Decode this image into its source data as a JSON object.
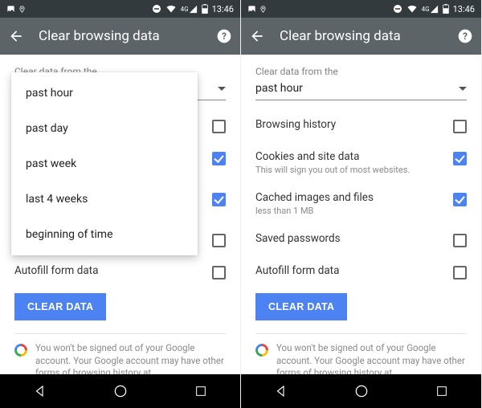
{
  "statusbar": {
    "clock": "13:46"
  },
  "header": {
    "title": "Clear browsing data"
  },
  "label": {
    "clear_from": "Clear data from the"
  },
  "dropdown": {
    "selected": "past hour",
    "options": [
      "past hour",
      "past day",
      "past week",
      "last 4 weeks",
      "beginning of time"
    ]
  },
  "rows": {
    "browsing_history": {
      "title": "Browsing history",
      "checked": false
    },
    "cookies": {
      "title": "Cookies and site data",
      "sub": "This will sign you out of most websites.",
      "checked": true
    },
    "cached": {
      "title": "Cached images and files",
      "sub": "less than 1 MB",
      "checked": true
    },
    "saved_passwords": {
      "title": "Saved passwords",
      "checked": false
    },
    "autofill": {
      "title": "Autofill form data",
      "checked": false
    }
  },
  "button": {
    "clear_data": "CLEAR DATA"
  },
  "note": "You won't be signed out of your Google account. Your Google account may have other forms of browsing history at"
}
